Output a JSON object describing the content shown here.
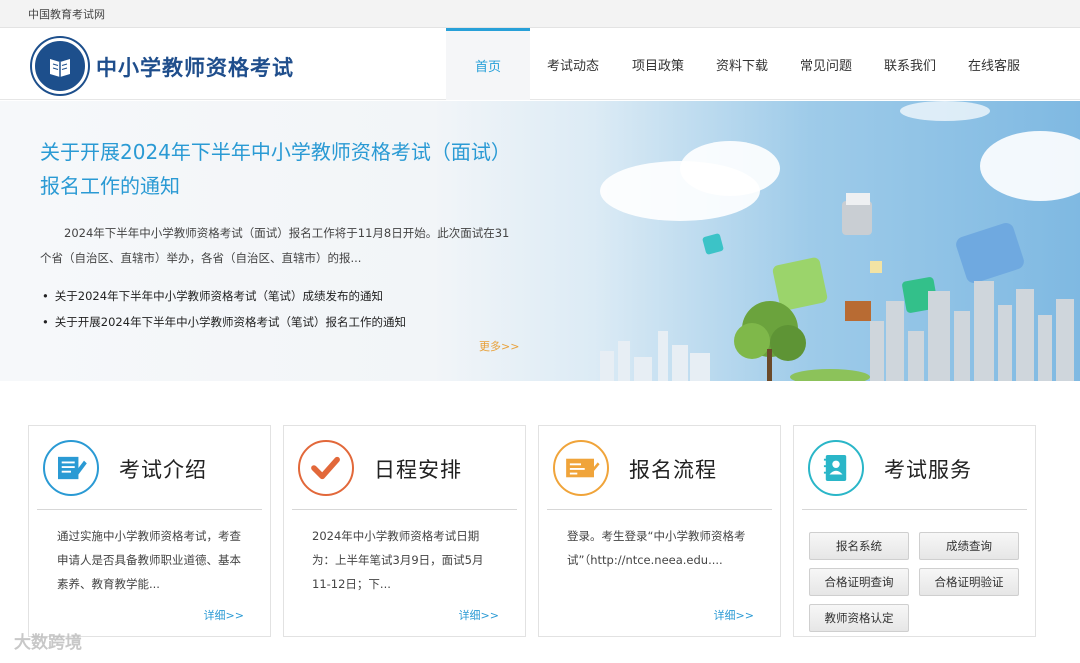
{
  "topbar": {
    "site_name": "中国教育考试网"
  },
  "header": {
    "title": "中小学教师资格考试"
  },
  "nav": [
    {
      "label": "首页"
    },
    {
      "label": "考试动态"
    },
    {
      "label": "项目政策"
    },
    {
      "label": "资料下载"
    },
    {
      "label": "常见问题"
    },
    {
      "label": "联系我们"
    },
    {
      "label": "在线客服"
    }
  ],
  "banner": {
    "title": "关于开展2024年下半年中小学教师资格考试（面试）报名工作的通知",
    "desc": "2024年下半年中小学教师资格考试（面试）报名工作将于11月8日开始。此次面试在31个省（自治区、直辖市）举办，各省（自治区、直辖市）的报...",
    "links": [
      "关于2024年下半年中小学教师资格考试（笔试）成绩发布的通知",
      "关于开展2024年下半年中小学教师资格考试（笔试）报名工作的通知"
    ],
    "more": "更多>>"
  },
  "cards": [
    {
      "title": "考试介绍",
      "body": "通过实施中小学教师资格考试，考查申请人是否具备教师职业道德、基本素养、教育教学能...",
      "more": "详细>>"
    },
    {
      "title": "日程安排",
      "body": "2024年中小学教师资格考试日期为：上半年笔试3月9日，面试5月11-12日；下...",
      "more": "详细>>"
    },
    {
      "title": "报名流程",
      "body": "登录。考生登录“中小学教师资格考试”（http://ntce.neea.edu....",
      "more": "详细>>"
    },
    {
      "title": "考试服务",
      "buttons": [
        "报名系统",
        "成绩查询",
        "合格证明查询",
        "合格证明验证",
        "教师资格认定"
      ]
    }
  ],
  "watermark": "大数跨境",
  "colors": {
    "accent": "#27a0d8",
    "brand": "#1f4e8c",
    "more": "#e8a13a"
  }
}
